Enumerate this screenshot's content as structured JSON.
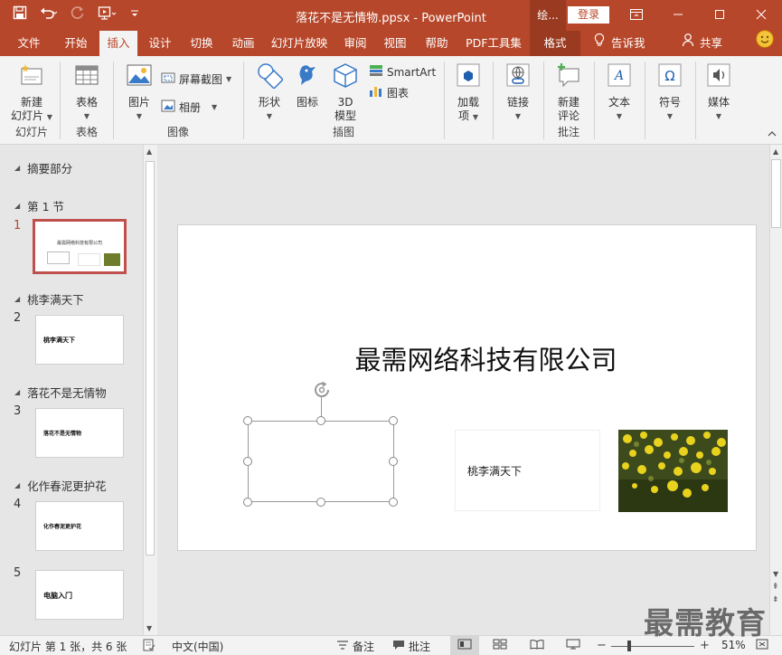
{
  "window": {
    "title": "落花不是无情物.ppsx - PowerPoint",
    "ctx_tab_short": "绘...",
    "login_label": "登录"
  },
  "tabs": [
    {
      "label": "文件"
    },
    {
      "label": "开始"
    },
    {
      "label": "插入"
    },
    {
      "label": "设计"
    },
    {
      "label": "切换"
    },
    {
      "label": "动画"
    },
    {
      "label": "幻灯片放映"
    },
    {
      "label": "审阅"
    },
    {
      "label": "视图"
    },
    {
      "label": "帮助"
    },
    {
      "label": "PDF工具集"
    },
    {
      "label": "格式"
    }
  ],
  "tell_me": "告诉我",
  "share": "共享",
  "ribbon": {
    "groups": {
      "slides": "幻灯片",
      "tables": "表格",
      "images": "图像",
      "illustrations": "插图",
      "comments": "批注"
    },
    "new_slide": [
      "新建",
      "幻灯片"
    ],
    "table": "表格",
    "pictures": "图片",
    "screenshot": "屏幕截图",
    "album": "相册",
    "shapes": "形状",
    "icons": "图标",
    "model3d": [
      "3D",
      "模型"
    ],
    "smartart": "SmartArt",
    "chart": "图表",
    "addins": [
      "加载",
      "项"
    ],
    "link": "链接",
    "new_comment": [
      "新建",
      "评论"
    ],
    "text": "文本",
    "symbols": "符号",
    "media": "媒体"
  },
  "outline": {
    "sections": [
      "摘要部分",
      "第 1 节",
      "桃李满天下",
      "落花不是无情物",
      "化作春泥更护花"
    ],
    "slide_numbers": [
      "1",
      "2",
      "3",
      "4",
      "5"
    ],
    "thumb_texts": [
      "最需网络科技有限公司",
      "桃李满天下",
      "落花不是无情物",
      "化作春泥更护花",
      "电脑入门"
    ]
  },
  "slide": {
    "title": "最需网络科技有限公司",
    "textbox": "桃李满天下"
  },
  "status": {
    "slide_info": "幻灯片 第 1 张，共 6 张",
    "language": "中文(中国)",
    "notes": "备注",
    "comments": "批注",
    "zoom": "51%"
  },
  "watermark": "最需教育",
  "colors": {
    "brand": "#b7472a",
    "brand_dark": "#9a3a20",
    "active_slide_border": "#c0504d"
  }
}
